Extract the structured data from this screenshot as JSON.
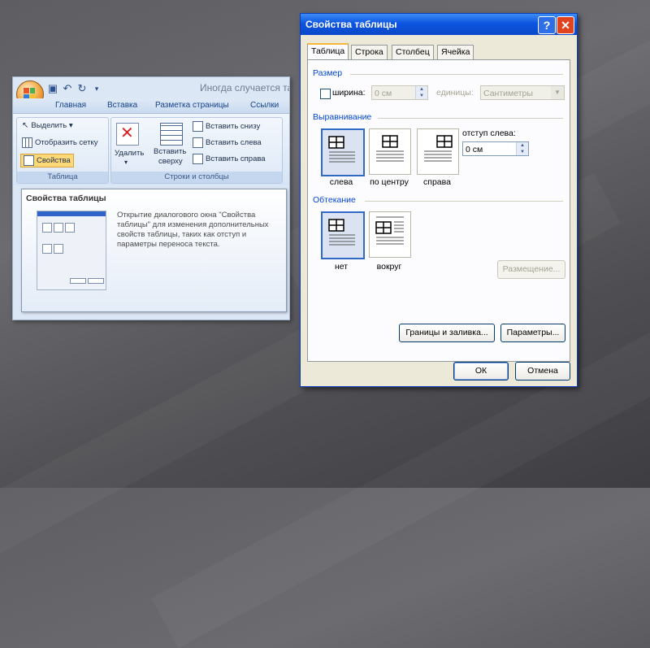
{
  "word_window": {
    "doc_title": "Иногда случается так",
    "ribbon_tabs": [
      "Главная",
      "Вставка",
      "Разметка страницы",
      "Ссылки"
    ],
    "groups": {
      "table": {
        "label": "Таблица",
        "items": [
          "Выделить ▾",
          "Отобразить сетку",
          "Свойства"
        ]
      },
      "rows_cols": {
        "label": "Строки и столбцы",
        "delete": "Удалить",
        "insert_above_1": "Вставить",
        "insert_above_2": "сверху",
        "insert_below": "Вставить снизу",
        "insert_left": "Вставить слева",
        "insert_right": "Вставить справа"
      }
    },
    "tooltip": {
      "title": "Свойства таблицы",
      "text": "Открытие диалогового окна \"Свойства таблицы\" для изменения дополнительных свойств таблицы, таких как отступ и параметры переноса текста."
    }
  },
  "dialog": {
    "title": "Свойства таблицы",
    "help_button": "?",
    "close_button": "✕",
    "tabs": [
      "Таблица",
      "Строка",
      "Столбец",
      "Ячейка"
    ],
    "size": {
      "heading": "Размер",
      "width_label": "ширина:",
      "width_value": "0 см",
      "units_label": "единицы:",
      "units_value": "Сантиметры"
    },
    "alignment": {
      "heading": "Выравнивание",
      "options": [
        "слева",
        "по центру",
        "справа"
      ],
      "indent_label": "отступ слева:",
      "indent_value": "0 см"
    },
    "wrapping": {
      "heading": "Обтекание",
      "options": [
        "нет",
        "вокруг"
      ],
      "placement_button": "Размещение..."
    },
    "borders_button": "Границы и заливка...",
    "options_button": "Параметры...",
    "ok_button": "ОК",
    "cancel_button": "Отмена"
  },
  "colors": {
    "titlebar": "#0d55e0",
    "dialog_bg": "#ece9d8",
    "section_heading": "#0046d5",
    "ribbon_bg": "#dce7f5"
  }
}
